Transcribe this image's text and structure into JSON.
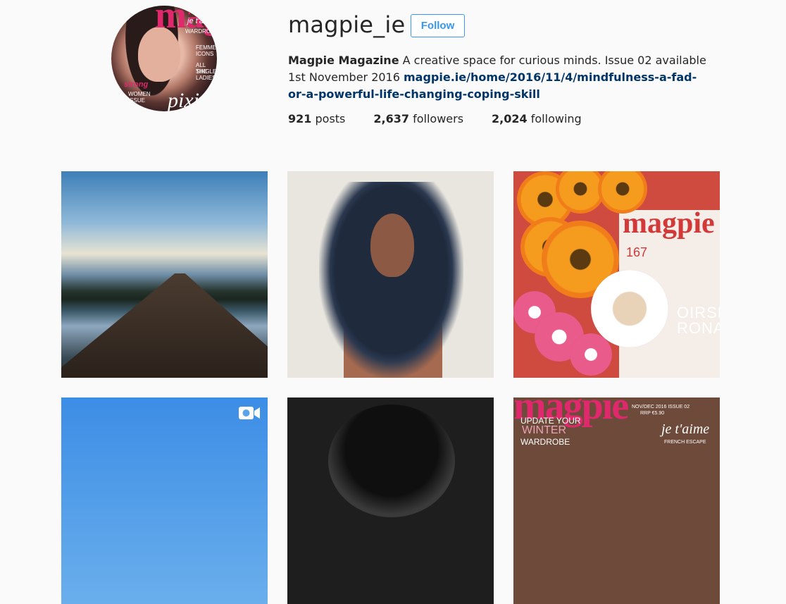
{
  "profile": {
    "username": "magpie_ie",
    "follow_label": "Follow",
    "bio_name": "Magpie Magazine",
    "bio_text": " A creative space for curious minds. Issue 02 available 1st November 2016 ",
    "bio_link": "magpie.ie/home/2016/11/4/mindfulness-a-fad-or-a-powerful-life-changing-coping-skill",
    "stats": [
      {
        "count": "921",
        "label": "posts"
      },
      {
        "count": "2,637",
        "label": "followers"
      },
      {
        "count": "2,024",
        "label": "following"
      }
    ],
    "avatar_cover": {
      "masthead": "mag",
      "lines": [
        "je t'aime",
        "WARDROBE",
        "ALL THE",
        "SINGLE",
        "LADIES",
        "FEMME",
        "ICONS"
      ],
      "highlight_1": "strong",
      "highlight_2": "WOMEN",
      "highlight_3": "ISSUE",
      "script": "pixie"
    }
  },
  "posts": [
    {
      "id": 1,
      "kind": "photo",
      "subject": "dock-lake-sunset"
    },
    {
      "id": 2,
      "kind": "photo",
      "subject": "portrait-curlers"
    },
    {
      "id": 3,
      "kind": "photo",
      "subject": "flowers-magazine",
      "cover_title": "magpie",
      "cover_number": "167",
      "cover_name": "OIRSE RONAN"
    },
    {
      "id": 4,
      "kind": "video",
      "subject": "blue-sky",
      "icon": "video-camera-icon"
    },
    {
      "id": 5,
      "kind": "photo",
      "subject": "black-white-portrait"
    },
    {
      "id": 6,
      "kind": "photo",
      "subject": "magazine-cover",
      "cover_issue": "NOV/DEC 2016 ISSUE 02",
      "cover_price": "RRP €5.90",
      "cover_line_1": "UPDATE YOUR",
      "cover_line_2": "WINTER",
      "cover_line_3": "WARDROBE",
      "cover_script": "je t'aime",
      "cover_sub": "FRENCH ESCAPE"
    }
  ],
  "colors": {
    "background": "#fafafa",
    "link": "#003569",
    "follow_blue": "#3897f0",
    "text": "#262626",
    "brand_pink": "#e0286c"
  }
}
